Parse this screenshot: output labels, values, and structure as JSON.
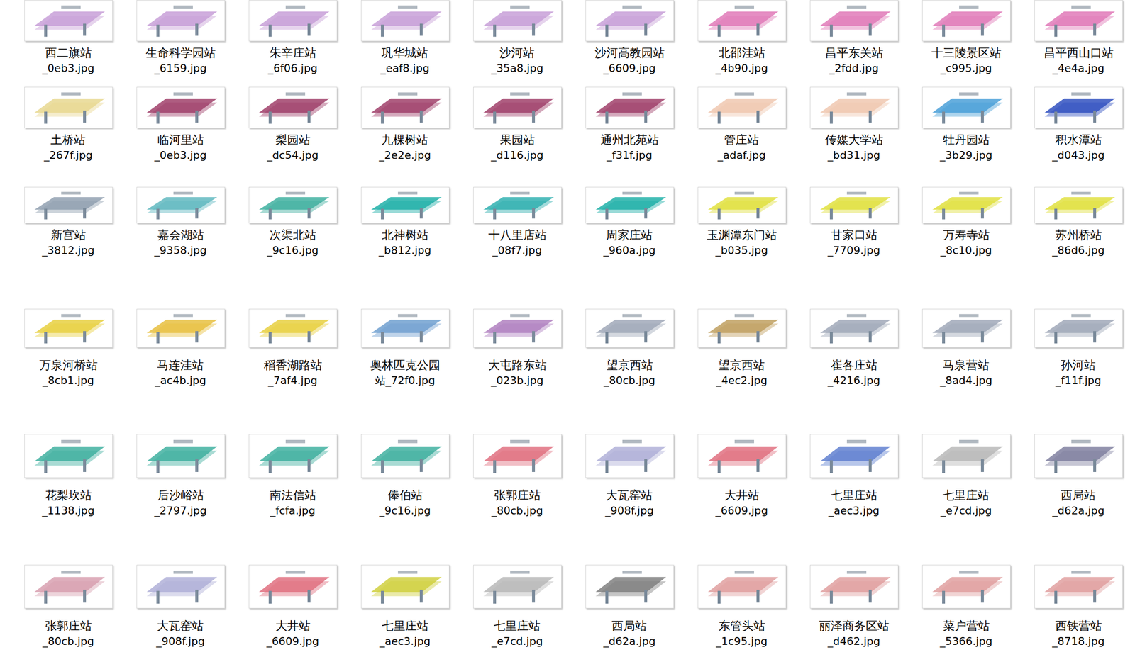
{
  "view": "file-explorer-large-icons",
  "rows": [
    {
      "items": [
        {
          "name": "西二旗站",
          "file": "_0eb3.jpg",
          "color": "#c8a0d8"
        },
        {
          "name": "生命科学园站",
          "file": "_6159.jpg",
          "color": "#c8a0d8"
        },
        {
          "name": "朱辛庄站",
          "file": "_6f06.jpg",
          "color": "#c8a0d8"
        },
        {
          "name": "巩华城站",
          "file": "_eaf8.jpg",
          "color": "#c8a0d8"
        },
        {
          "name": "沙河站",
          "file": "_35a8.jpg",
          "color": "#c8a0d8"
        },
        {
          "name": "沙河高教园站",
          "file": "_6609.jpg",
          "color": "#c8a0d8"
        },
        {
          "name": "北邵洼站",
          "file": "_4b90.jpg",
          "color": "#e07ab8"
        },
        {
          "name": "昌平东关站",
          "file": "_2fdd.jpg",
          "color": "#e07ab8"
        },
        {
          "name": "十三陵景区站",
          "file": "_c995.jpg",
          "color": "#e07ab8"
        },
        {
          "name": "昌平西山口站",
          "file": "_4e4a.jpg",
          "color": "#e07ab8"
        }
      ]
    },
    {
      "items": [
        {
          "name": "土桥站",
          "file": "_267f.jpg",
          "color": "#e8d890"
        },
        {
          "name": "临河里站",
          "file": "_0eb3.jpg",
          "color": "#a0406a"
        },
        {
          "name": "梨园站",
          "file": "_dc54.jpg",
          "color": "#a0406a"
        },
        {
          "name": "九棵树站",
          "file": "_2e2e.jpg",
          "color": "#a0406a"
        },
        {
          "name": "果园站",
          "file": "_d116.jpg",
          "color": "#a0406a"
        },
        {
          "name": "通州北苑站",
          "file": "_f31f.jpg",
          "color": "#a0406a"
        },
        {
          "name": "管庄站",
          "file": "_adaf.jpg",
          "color": "#f0c8b0"
        },
        {
          "name": "传媒大学站",
          "file": "_bd31.jpg",
          "color": "#f0c8b0"
        },
        {
          "name": "牡丹园站",
          "file": "_3b29.jpg",
          "color": "#4aa0d8"
        },
        {
          "name": "积水潭站",
          "file": "_d043.jpg",
          "color": "#3050c0"
        }
      ]
    },
    {
      "items": [
        {
          "name": "新宫站",
          "file": "_3812.jpg",
          "color": "#90a0b0"
        },
        {
          "name": "嘉会湖站",
          "file": "_9358.jpg",
          "color": "#60b8c0"
        },
        {
          "name": "次渠北站",
          "file": "_9c16.jpg",
          "color": "#40b0a0"
        },
        {
          "name": "北神树站",
          "file": "_b812.jpg",
          "color": "#20b0a8"
        },
        {
          "name": "十八里店站",
          "file": "_08f7.jpg",
          "color": "#30b0b0"
        },
        {
          "name": "周家庄站",
          "file": "_960a.jpg",
          "color": "#20b0a8"
        },
        {
          "name": "玉渊潭东门站",
          "file": "_b035.jpg",
          "color": "#e0e040"
        },
        {
          "name": "甘家口站",
          "file": "_7709.jpg",
          "color": "#e0e040"
        },
        {
          "name": "万寿寺站",
          "file": "_8c10.jpg",
          "color": "#e0e040"
        },
        {
          "name": "苏州桥站",
          "file": "_86d6.jpg",
          "color": "#e0e040"
        }
      ]
    },
    {
      "items": [
        {
          "name": "万泉河桥站",
          "file": "_8cb1.jpg",
          "color": "#e8d040"
        },
        {
          "name": "马连洼站",
          "file": "_ac4b.jpg",
          "color": "#e8c040"
        },
        {
          "name": "稻香湖路站",
          "file": "_7af4.jpg",
          "color": "#e8d040"
        },
        {
          "name": "奥林匹克公园",
          "file": "站_72f0.jpg",
          "color": "#70a0d0"
        },
        {
          "name": "大屯路东站",
          "file": "_023b.jpg",
          "color": "#b080c0"
        },
        {
          "name": "望京西站",
          "file": "_80cb.jpg",
          "color": "#a0a8b8"
        },
        {
          "name": "望京西站",
          "file": "_4ec2.jpg",
          "color": "#c0a060"
        },
        {
          "name": "崔各庄站",
          "file": "_4216.jpg",
          "color": "#a0a8b8"
        },
        {
          "name": "马泉营站",
          "file": "_8ad4.jpg",
          "color": "#a0a8b8"
        },
        {
          "name": "孙河站",
          "file": "_f11f.jpg",
          "color": "#a0a8b8"
        }
      ]
    },
    {
      "items": [
        {
          "name": "花梨坎站",
          "file": "_1138.jpg",
          "color": "#40b0a0"
        },
        {
          "name": "后沙峪站",
          "file": "_2797.jpg",
          "color": "#40b0a0"
        },
        {
          "name": "南法信站",
          "file": "_fcfa.jpg",
          "color": "#40b0a0"
        },
        {
          "name": "俸伯站",
          "file": "_9c16.jpg",
          "color": "#40b0a0"
        },
        {
          "name": "张郭庄站",
          "file": "_80cb.jpg",
          "color": "#e07080"
        },
        {
          "name": "大瓦窑站",
          "file": "_908f.jpg",
          "color": "#b0b0d8"
        },
        {
          "name": "大井站",
          "file": "_6609.jpg",
          "color": "#e07080"
        },
        {
          "name": "七里庄站",
          "file": "_aec3.jpg",
          "color": "#6080d0"
        },
        {
          "name": "七里庄站",
          "file": "_e7cd.jpg",
          "color": "#b8b8b8"
        },
        {
          "name": "西局站",
          "file": "_d62a.jpg",
          "color": "#8080a0"
        }
      ]
    },
    {
      "items": [
        {
          "name": "张郭庄站",
          "file": "_80cb.jpg",
          "color": "#d8a0b0"
        },
        {
          "name": "大瓦窑站",
          "file": "_908f.jpg",
          "color": "#b0b0d8"
        },
        {
          "name": "大井站",
          "file": "_6609.jpg",
          "color": "#e07080"
        },
        {
          "name": "七里庄站",
          "file": "_aec3.jpg",
          "color": "#d0d040"
        },
        {
          "name": "七里庄站",
          "file": "_e7cd.jpg",
          "color": "#b8b8b8"
        },
        {
          "name": "西局站",
          "file": "_d62a.jpg",
          "color": "#808080"
        },
        {
          "name": "东管头站",
          "file": "_1c95.jpg",
          "color": "#e0a0a0"
        },
        {
          "name": "丽泽商务区站",
          "file": "_d462.jpg",
          "color": "#e0a0a0"
        },
        {
          "name": "菜户营站",
          "file": "_5366.jpg",
          "color": "#e0a0a0"
        },
        {
          "name": "西铁营站",
          "file": "_8718.jpg",
          "color": "#e0a0a0"
        }
      ]
    }
  ]
}
